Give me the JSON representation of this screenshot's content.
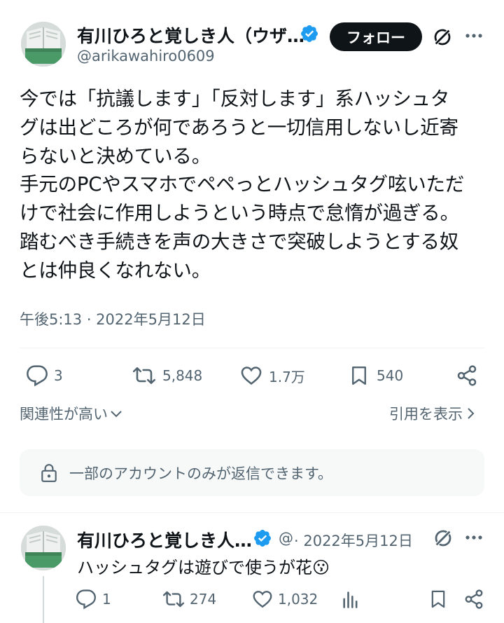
{
  "tweet": {
    "author_name": "有川ひろと覚しき人（ウザ…",
    "handle": "@arikawahiro0609",
    "follow_label": "フォロー",
    "text": "今では「抗議します」「反対します」系ハッシュタ\nグは出どころが何であろうと一切信用しないし近寄\nらないと決めている。\n手元のPCやスマホでペペっとハッシュタグ呟いただ\nけで社会に作用しようという時点で怠惰が過ぎる。\n踏むべき手続きを声の大きさで突破しようとする奴\nとは仲良くなれない。",
    "timestamp": "午後5:13 · 2022年5月12日",
    "replies": "3",
    "retweets": "5,848",
    "likes": "1.7万",
    "bookmarks": "540"
  },
  "sort": {
    "relevance_label": "関連性が高い",
    "quotes_label": "引用を表示"
  },
  "reply_restriction": {
    "text": "一部のアカウントのみが返信できます。"
  },
  "reply": {
    "author_name": "有川ひろと覚しき人…",
    "handle_short": "@",
    "date": "· 2022年5月12日",
    "text": "ハッシュタグは遊びで使うが花😗",
    "replies": "1",
    "retweets": "274",
    "likes": "1,032"
  },
  "colors": {
    "verified": "#1d9bf0",
    "text_primary": "#0f1419",
    "text_secondary": "#536471"
  }
}
